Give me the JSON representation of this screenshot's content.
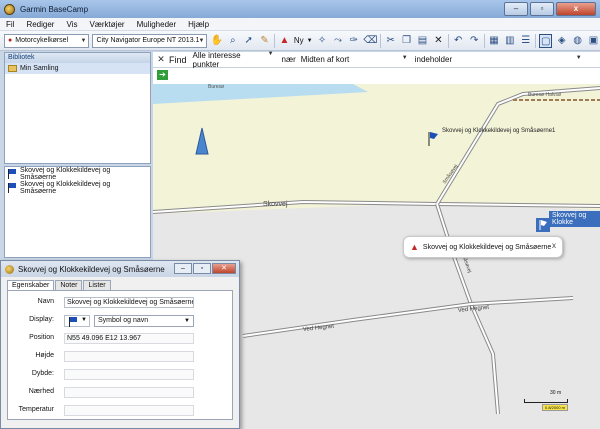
{
  "window": {
    "title": "Garmin BaseCamp",
    "close": "x"
  },
  "menu": [
    "Fil",
    "Rediger",
    "Vis",
    "Værktøjer",
    "Muligheder",
    "Hjælp"
  ],
  "toolbar": {
    "profile": "Motorcykelkørsel",
    "map_product": "City Navigator Europe NT 2013.1",
    "new_label": "Ny"
  },
  "library": {
    "header": "Bibliotek",
    "items": [
      "Min Samling"
    ]
  },
  "list": {
    "rows": [
      "Skovvej og Klokkekildevej og Småsøerne",
      "Skovvej og Klokkekildevej og Småsøerne"
    ]
  },
  "find": {
    "label": "Find",
    "category": "Alle interesse punkter",
    "near_word": "nær",
    "near_value": "Midten af kort",
    "mode": "indeholder"
  },
  "map": {
    "road_labels": {
      "buresø_top": "Buresø",
      "buresø_right": "Buresø Halvsø",
      "skovvej": "Skovvej",
      "småsøvej": "Småsøvej",
      "ved_hegnet_1": "Ved Hegnet",
      "ved_hegnet_2": "Ved Hegnet",
      "vertical": "Småsøvej"
    },
    "waypoint_label": "Skovvej og Klokkekildevej og Småsøerne1",
    "highlight_label": "Skovvej og Klokke",
    "callout_text": "Skovvej og Klokkekildevej og Småsøerne",
    "callout_close": "x",
    "scale_label": "30 m",
    "scale_box": "0.8/2000 m"
  },
  "dialog": {
    "title": "Skovvej og Klokkekildevej og Småsøerne",
    "tabs": [
      "Egenskaber",
      "Noter",
      "Lister"
    ],
    "fields": {
      "navn_label": "Navn",
      "navn_value": "Skovvej og Klokkekildevej og Småsøerne",
      "display_label": "Display:",
      "display_value": "Symbol og navn",
      "position_label": "Position",
      "position_value": "N55 49.096 E12 13.967",
      "hojde_label": "Højde",
      "dybde_label": "Dybde:",
      "naehed_label": "Nærhed",
      "temperatur_label": "Temperatur"
    }
  },
  "colors": {
    "map_land": "#f3f3d8",
    "map_area": "#e7e7e7",
    "water": "#b8dcf0",
    "flag_blue": "#1d4fb8"
  }
}
